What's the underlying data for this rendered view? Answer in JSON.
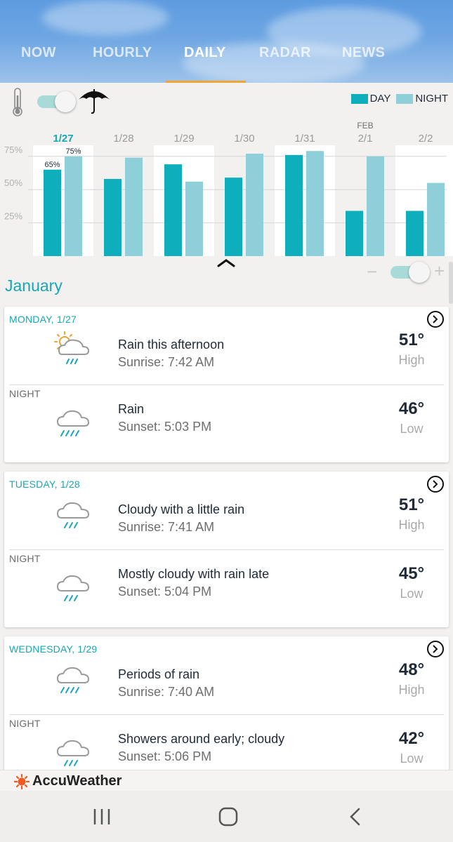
{
  "tabs": [
    "NOW",
    "HOURLY",
    "DAILY",
    "RADAR",
    "NEWS"
  ],
  "active_tab": "DAILY",
  "legend": {
    "day": "DAY",
    "night": "NIGHT",
    "day_color": "#0eaebd",
    "night_color": "#8ecfd9"
  },
  "chart_data": {
    "type": "bar",
    "title": "",
    "categories": [
      "1/27",
      "1/28",
      "1/29",
      "1/30",
      "1/31",
      "2/1",
      "2/2"
    ],
    "category_prefix": {
      "2/1": "FEB"
    },
    "selected_category": "1/27",
    "series": [
      {
        "name": "DAY",
        "values": [
          65,
          58,
          69,
          59,
          76,
          34,
          34
        ]
      },
      {
        "name": "NIGHT",
        "values": [
          75,
          74,
          56,
          77,
          79,
          75,
          55
        ]
      }
    ],
    "data_labels": {
      "1/27": [
        "65%",
        "75%"
      ]
    },
    "yticks": [
      "25%",
      "50%",
      "75%"
    ],
    "ylim": [
      0,
      100
    ],
    "highlighted_columns": [
      "1/27",
      "1/29",
      "1/31",
      "2/2"
    ],
    "grid": true
  },
  "month": "January",
  "days": [
    {
      "label": "MONDAY, 1/27",
      "day": {
        "icon": "partly-sunny-rain-icon",
        "desc": "Rain this afternoon",
        "sun": "Sunrise: 7:42 AM",
        "temp": "51°",
        "temp_label": "High"
      },
      "night_label": "NIGHT",
      "night": {
        "icon": "rain-cloud-icon",
        "desc": "Rain",
        "sun": "Sunset: 5:03 PM",
        "temp": "46°",
        "temp_label": "Low"
      }
    },
    {
      "label": "TUESDAY, 1/28",
      "day": {
        "icon": "light-rain-cloud-icon",
        "desc": "Cloudy with a little rain",
        "sun": "Sunrise: 7:41 AM",
        "temp": "51°",
        "temp_label": "High"
      },
      "night_label": "NIGHT",
      "night": {
        "icon": "light-rain-cloud-icon",
        "desc": "Mostly cloudy with rain late",
        "sun": "Sunset: 5:04 PM",
        "temp": "45°",
        "temp_label": "Low"
      }
    },
    {
      "label": "WEDNESDAY, 1/29",
      "day": {
        "icon": "rain-cloud-icon",
        "desc": "Periods of rain",
        "sun": "Sunrise: 7:40 AM",
        "temp": "48°",
        "temp_label": "High"
      },
      "night_label": "NIGHT",
      "night": {
        "icon": "light-rain-cloud-icon",
        "desc": "Showers around early; cloudy",
        "sun": "Sunset: 5:06 PM",
        "temp": "42°",
        "temp_label": "Low"
      }
    }
  ],
  "brand": "AccuWeather"
}
